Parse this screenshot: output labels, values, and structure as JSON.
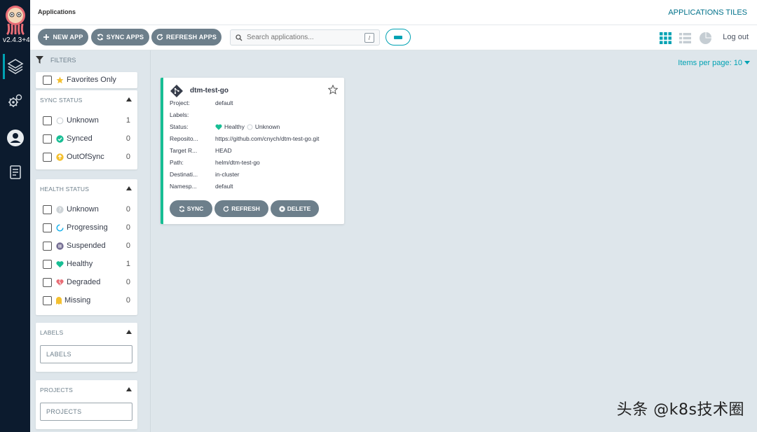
{
  "nav": {
    "version": "v2.4.3+4"
  },
  "header": {
    "title": "Applications",
    "view_title": "APPLICATIONS TILES"
  },
  "toolbar": {
    "new_app": "NEW APP",
    "sync_apps": "SYNC APPS",
    "refresh_apps": "REFRESH APPS",
    "search_placeholder": "Search applications...",
    "search_shortcut": "/",
    "logout": "Log out"
  },
  "filters": {
    "label": "FILTERS",
    "favorites": "Favorites Only",
    "sync_status": {
      "title": "SYNC STATUS",
      "items": [
        {
          "label": "Unknown",
          "count": "1"
        },
        {
          "label": "Synced",
          "count": "0"
        },
        {
          "label": "OutOfSync",
          "count": "0"
        }
      ]
    },
    "health_status": {
      "title": "HEALTH STATUS",
      "items": [
        {
          "label": "Unknown",
          "count": "0"
        },
        {
          "label": "Progressing",
          "count": "0"
        },
        {
          "label": "Suspended",
          "count": "0"
        },
        {
          "label": "Healthy",
          "count": "1"
        },
        {
          "label": "Degraded",
          "count": "0"
        },
        {
          "label": "Missing",
          "count": "0"
        }
      ]
    },
    "labels": {
      "title": "LABELS",
      "placeholder": "LABELS"
    },
    "projects": {
      "title": "PROJECTS",
      "placeholder": "PROJECTS"
    }
  },
  "pagination": {
    "items_per_page": "Items per page: 10"
  },
  "app": {
    "name": "dtm-test-go",
    "fields": [
      {
        "label": "Project:",
        "value": "default"
      },
      {
        "label": "Labels:",
        "value": ""
      },
      {
        "label": "Status:",
        "value": ""
      },
      {
        "label": "Reposito...",
        "value": "https://github.com/cnych/dtm-test-go.git"
      },
      {
        "label": "Target R...",
        "value": "HEAD"
      },
      {
        "label": "Path:",
        "value": "helm/dtm-test-go"
      },
      {
        "label": "Destinati...",
        "value": "in-cluster"
      },
      {
        "label": "Namesp...",
        "value": "default"
      }
    ],
    "health": "Healthy",
    "sync": "Unknown",
    "buttons": {
      "sync": "SYNC",
      "refresh": "REFRESH",
      "delete": "DELETE"
    }
  },
  "watermark": "头条 @k8s技术圈",
  "colors": {
    "accent": "#00a2b3",
    "healthy": "#18be94",
    "button": "#6d7f8b",
    "nav": "#0c1b2e"
  }
}
